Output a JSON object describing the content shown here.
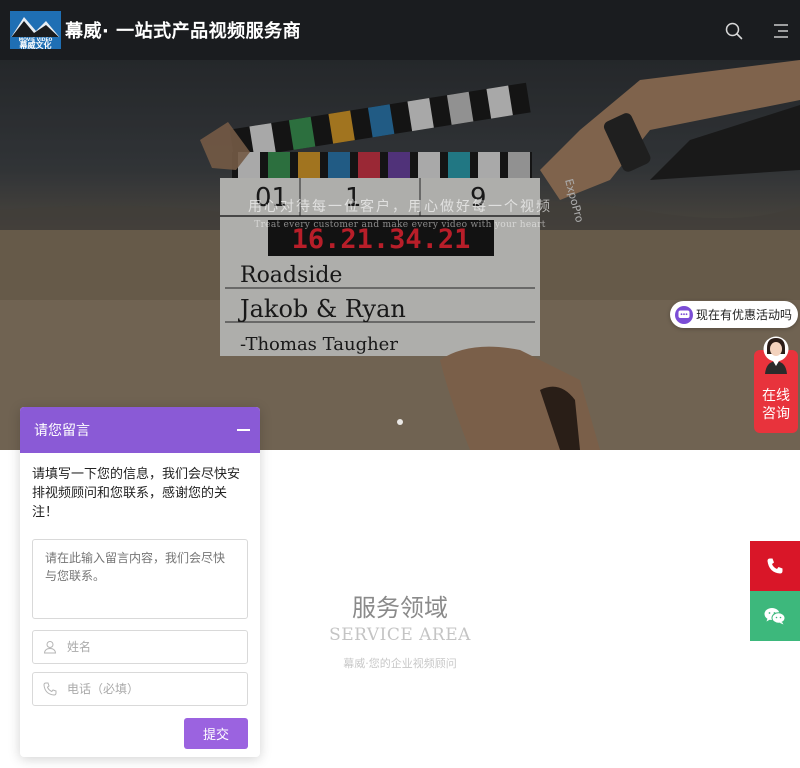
{
  "header": {
    "logo_text": "幕威文化",
    "logo_small_text": "MOVIE VIDEO",
    "site_title": "幕威· 一站式产品视频服务商",
    "icons": [
      "search-icon",
      "menu-icon"
    ],
    "background": "#1a1c1f"
  },
  "hero": {
    "slogan_cn": "用心对待每一位客户，用心做好每一个视频",
    "slogan_en": "Treat every customer and make every video with your heart",
    "slate": {
      "timecode": "16.21.34.21",
      "line1": "Roadside",
      "line2": "Jakob & Ryan",
      "line3": "-Thomas Taugher",
      "brand": "ExpoPro",
      "numbers": [
        "01",
        "1",
        "9"
      ]
    },
    "slide_count": 1,
    "active_slide": 1
  },
  "promo": {
    "bubble_text": "现在有优惠活动吗",
    "consult_line1": "在线",
    "consult_line2": "咨询",
    "accent": "#e8333c"
  },
  "service": {
    "title": "服务领域",
    "title_en": "SERVICE AREA",
    "subtitle": "幕威·您的企业视频顾问"
  },
  "side_buttons": {
    "phone_icon": "phone-icon",
    "wechat_icon": "wechat-icon",
    "phone_color": "#d91628",
    "wechat_color": "#3db87c"
  },
  "message_panel": {
    "title": "请您留言",
    "intro": "请填写一下您的信息，我们会尽快安排视频顾问和您联系，感谢您的关注！",
    "message_placeholder": "请在此输入留言内容，我们会尽快与您联系。",
    "name_placeholder": "姓名",
    "phone_placeholder": "电话（必填）",
    "submit_label": "提交",
    "accent": "#8a5ad6"
  }
}
